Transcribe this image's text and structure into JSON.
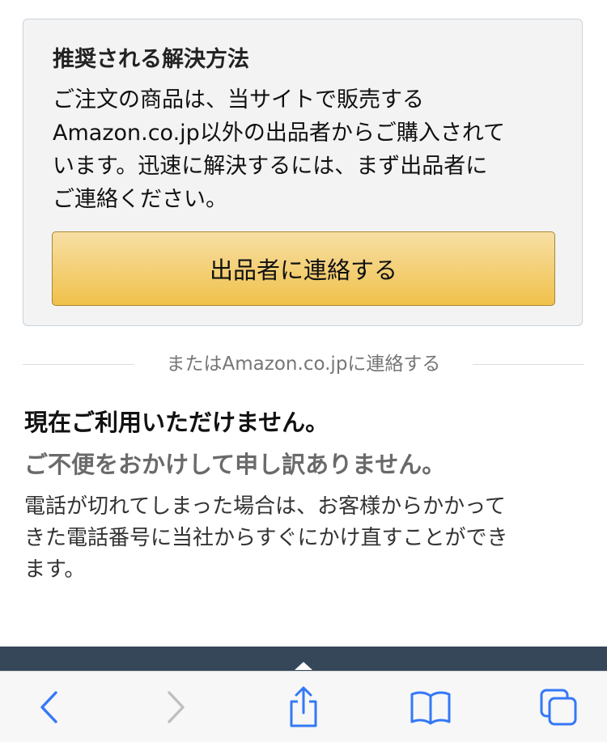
{
  "recommended": {
    "title": "推奨される解決方法",
    "body_lines": [
      "ご注文の商品は、当サイトで販売する",
      "Amazon.co.jp以外の出品者からご購入されて",
      "います。迅速に解決するには、まず出品者に",
      "ご連絡ください。"
    ],
    "button_label": "出品者に連絡する"
  },
  "divider": {
    "label": "またはAmazon.co.jpに連絡する"
  },
  "status": {
    "unavailable": "現在ご利用いただけません。",
    "apology": "ご不便をおかけして申し訳ありません。",
    "callback_lines": [
      "電話が切れてしまった場合は、お客様からかかって",
      "きた電話番号に当社からすぐにかけ直すことができ",
      "ます。"
    ]
  },
  "colors": {
    "accent_blue": "#3478f6",
    "disabled_gray": "#bfbfbf",
    "button_gold": "#f0c14b",
    "dark_bar": "#37475a"
  },
  "toolbar": {
    "icons": [
      "back-icon",
      "forward-icon",
      "share-icon",
      "bookmarks-icon",
      "tabs-icon"
    ]
  }
}
